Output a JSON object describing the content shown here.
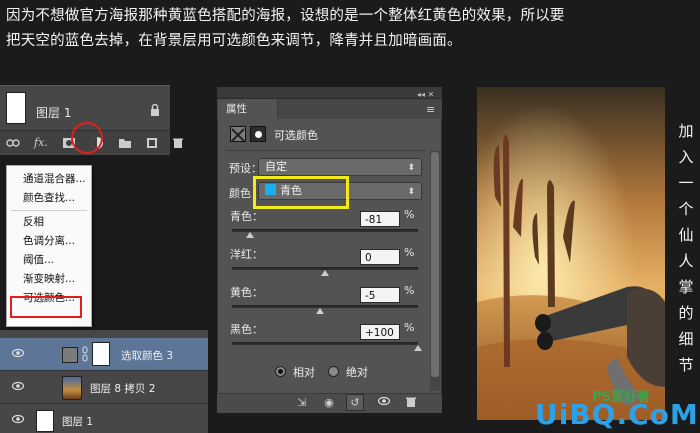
{
  "caption": {
    "line1": "因为不想做官方海报那种黄蓝色搭配的海报，设想的是一个整体红黄色的效果，所以要",
    "line2": "把天空的蓝色去掉，在背景层用可选颜色来调节，降青并且加暗画面。"
  },
  "layers_top": {
    "layer_name": "图层 1",
    "toolbar_icons": [
      "link-icon",
      "fx-icon",
      "mask-icon",
      "adjustment-icon",
      "folder-icon",
      "new-layer-icon",
      "trash-icon"
    ],
    "fx_label": "fx."
  },
  "adjustment_menu": {
    "items": [
      "通道混合器...",
      "颜色查找...",
      "反相",
      "色调分离...",
      "阈值...",
      "渐变映射...",
      "可选颜色..."
    ],
    "highlighted": "可选颜色..."
  },
  "layers_bottom": {
    "rows": [
      {
        "name": "选取颜色 3",
        "selected": true
      },
      {
        "name": "图层 8 拷贝 2",
        "selected": false
      },
      {
        "name": "图层 1",
        "selected": false
      }
    ]
  },
  "properties": {
    "tab_label": "属性",
    "panel_title": "可选颜色",
    "preset_label": "预设：",
    "preset_value": "自定",
    "color_label": "颜色：",
    "color_value": "青色",
    "color_swatch": "#1aaeea",
    "sliders": [
      {
        "label": "青色：",
        "value": "-81",
        "unit": "%",
        "level": -81
      },
      {
        "label": "洋红：",
        "value": "0",
        "unit": "%",
        "level": 0
      },
      {
        "label": "黄色：",
        "value": "-5",
        "unit": "%",
        "level": -5
      },
      {
        "label": "黑色：",
        "value": "+100",
        "unit": "%",
        "level": 100
      }
    ],
    "mode_relative": "相对",
    "mode_absolute": "绝对",
    "mode_selected": "相对"
  },
  "side_text": [
    "加",
    "入",
    "一",
    "个",
    "仙",
    "人",
    "掌",
    "的",
    "细",
    "节"
  ],
  "watermark": {
    "site": "UiBQ.CoM",
    "ps": "PS爱好者"
  },
  "colors": {
    "highlight_red": "#e01e1e",
    "highlight_yellow": "#f2ea1a",
    "selected_layer": "#5d7697"
  }
}
